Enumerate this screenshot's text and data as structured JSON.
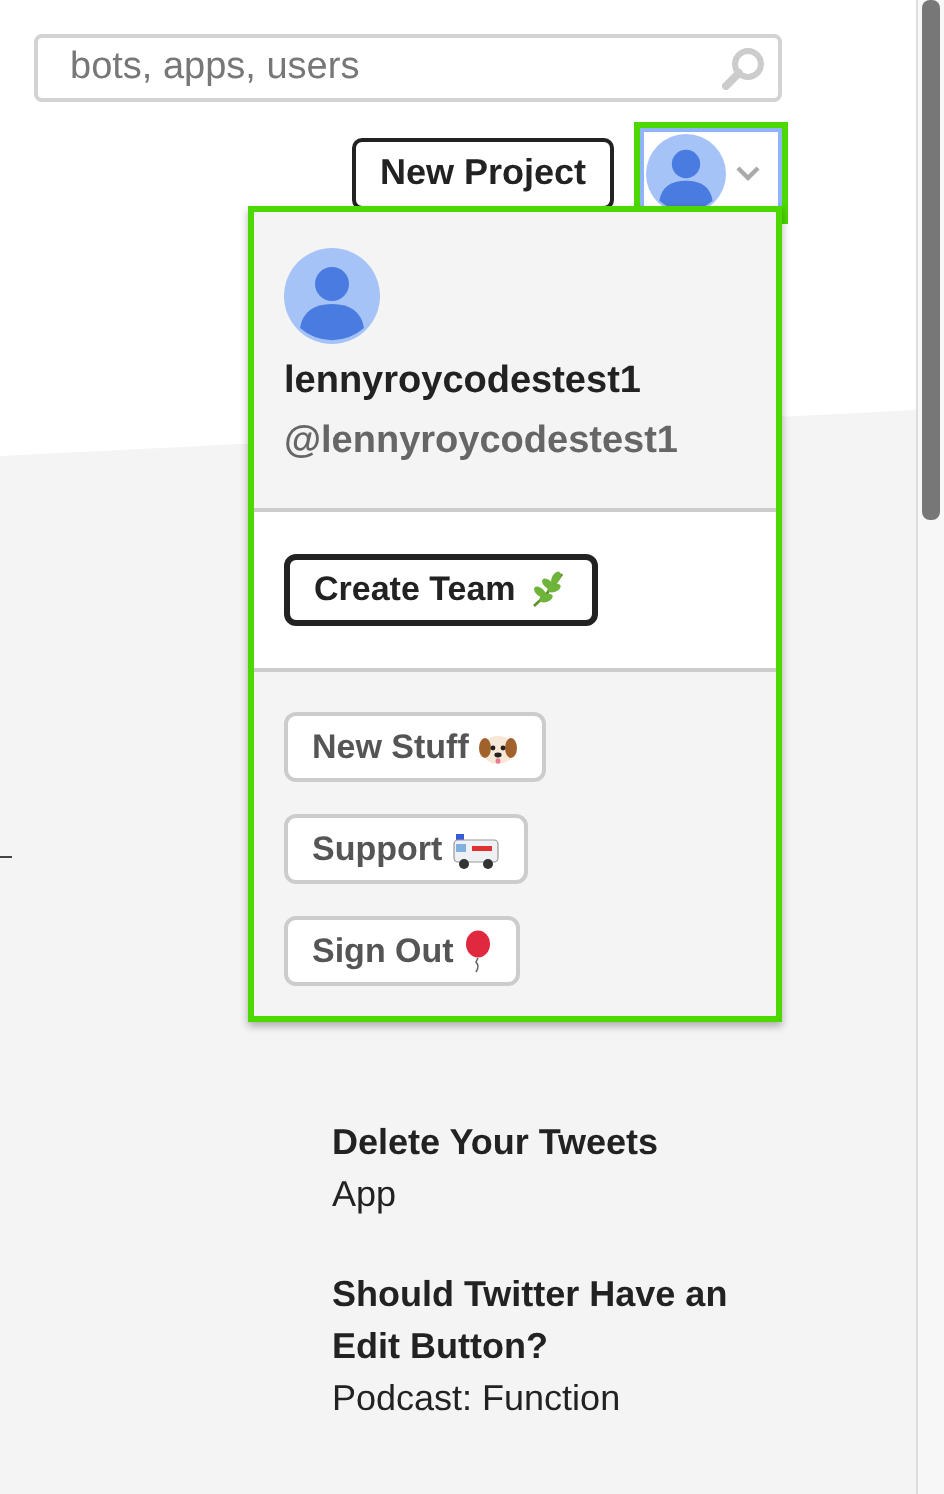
{
  "search": {
    "placeholder": "bots, apps, users"
  },
  "header": {
    "new_project": "New Project"
  },
  "account_menu": {
    "expanded": true,
    "name": "lennyroycodestest1",
    "handle": "@lennyroycodestest1",
    "create_team": "Create Team",
    "links": [
      {
        "label": "New Stuff"
      },
      {
        "label": "Support"
      },
      {
        "label": "Sign Out"
      }
    ]
  },
  "items": [
    {
      "title": "Delete Your Tweets",
      "subtitle": "App"
    },
    {
      "title": "Should Twitter Have an Edit Button?",
      "subtitle": "Podcast: Function"
    }
  ]
}
